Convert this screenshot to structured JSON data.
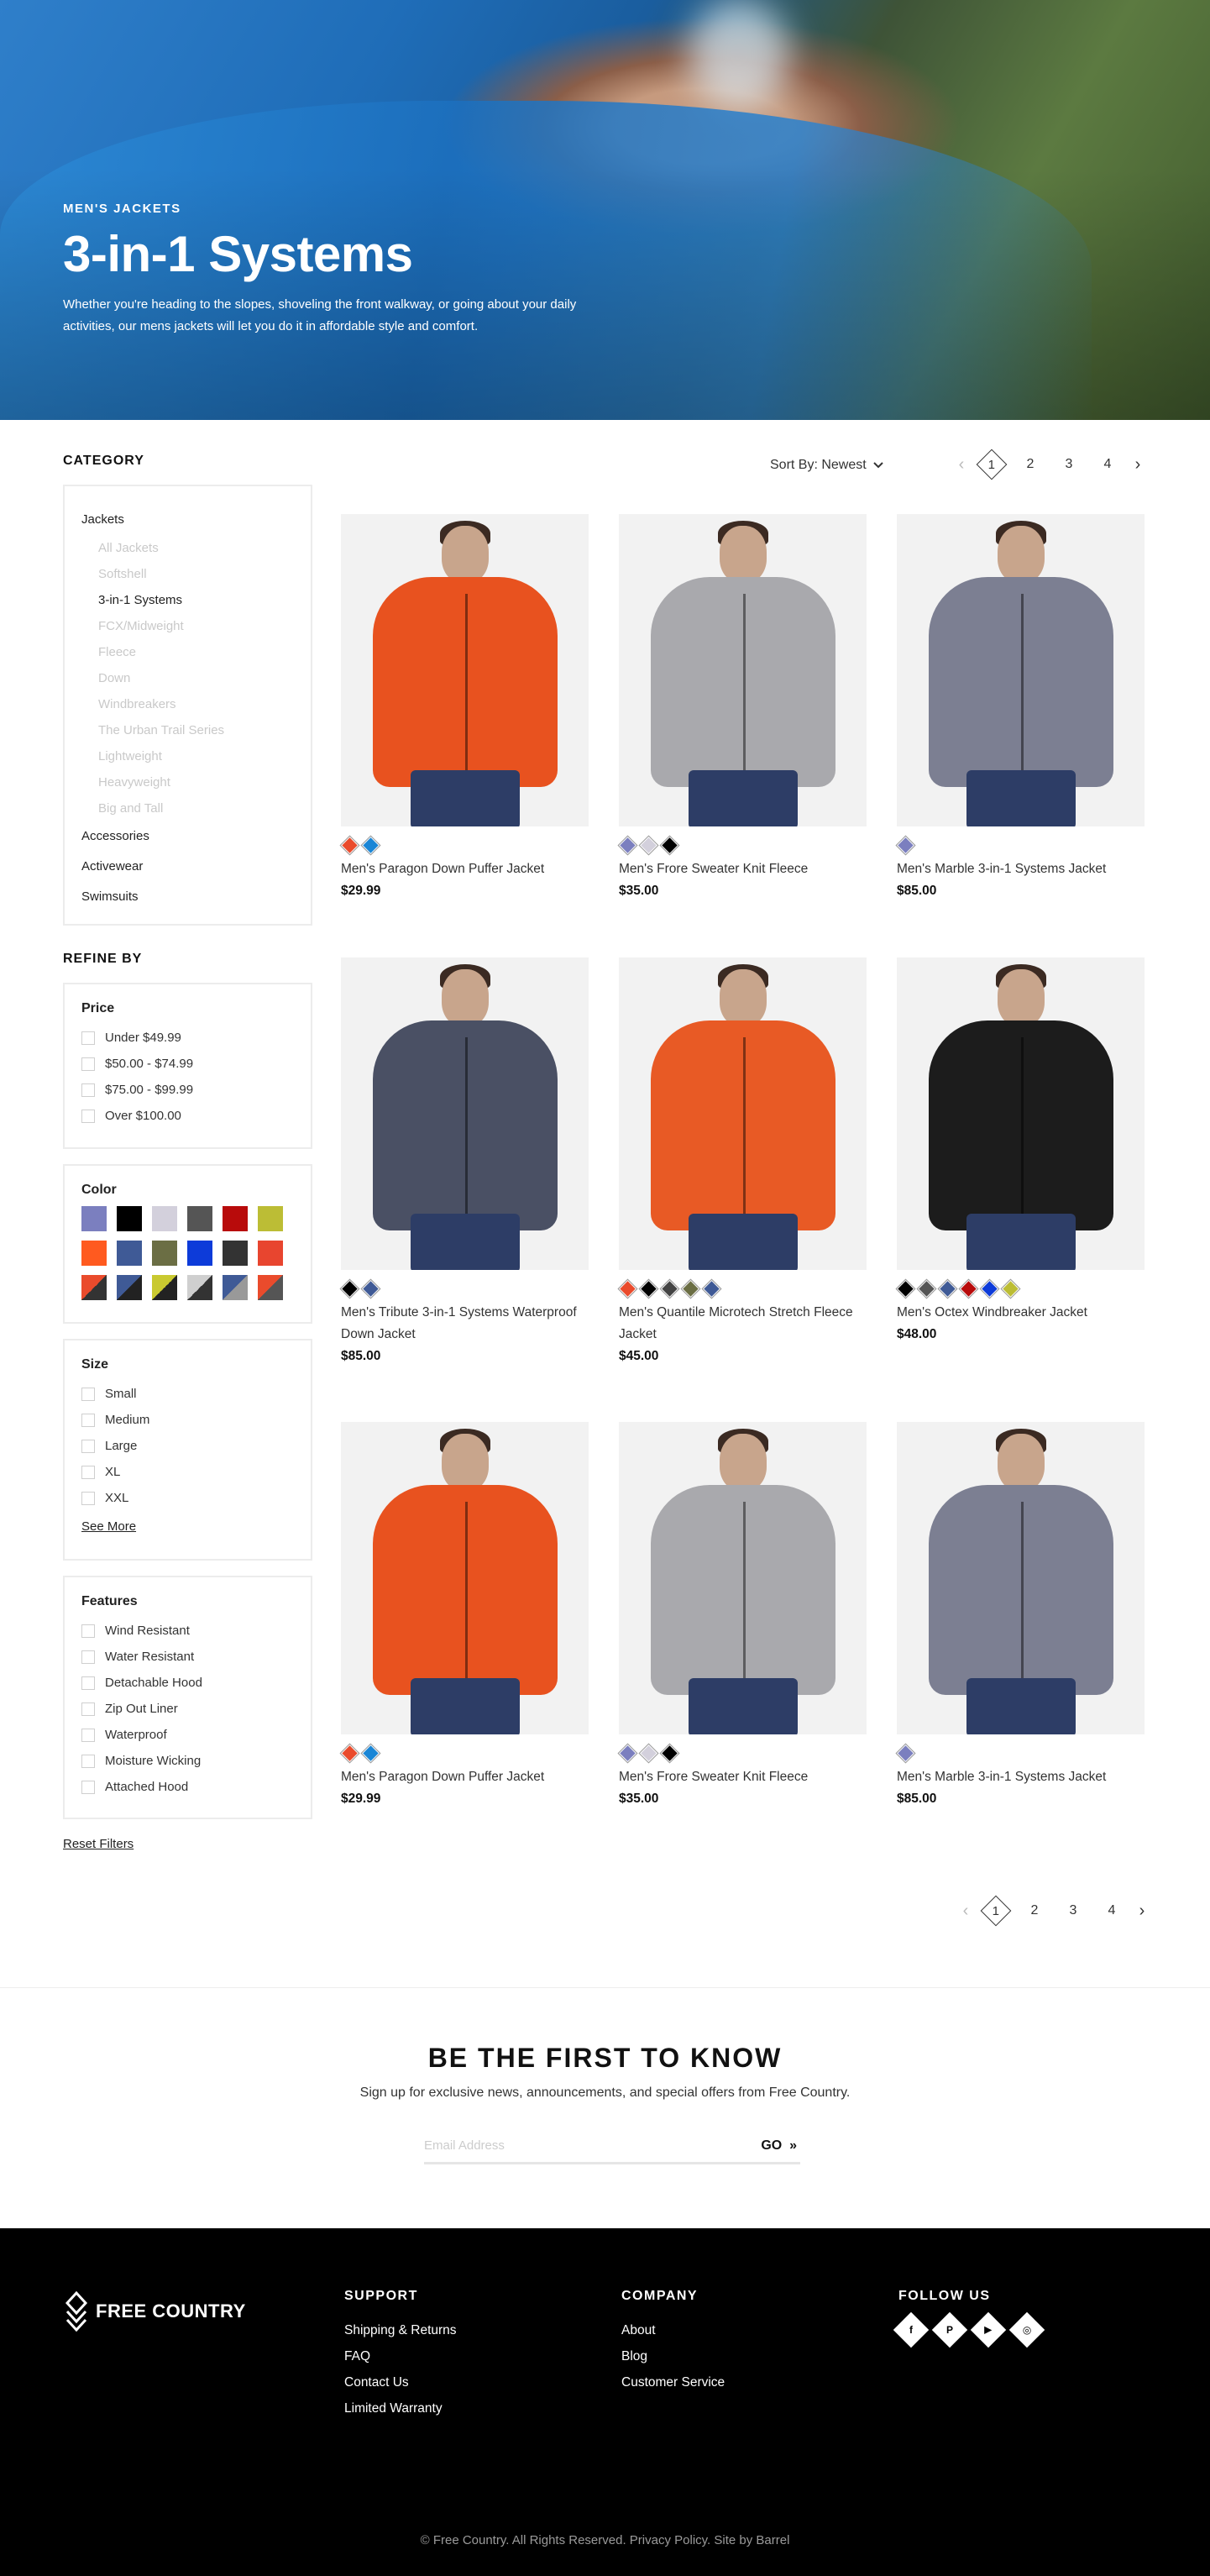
{
  "hero": {
    "eyebrow": "MEN'S JACKETS",
    "title": "3-in-1 Systems",
    "description": "Whether you're heading to the slopes, shoveling the front walkway, or going about your daily activities, our mens jackets will let you do it in affordable style and comfort."
  },
  "sidebar": {
    "category_heading": "CATEGORY",
    "categories": {
      "jackets": "Jackets",
      "sub": [
        "All Jackets",
        "Softshell",
        "3-in-1 Systems",
        "FCX/Midweight",
        "Fleece",
        "Down",
        "Windbreakers",
        "The Urban Trail Series",
        "Lightweight",
        "Heavyweight",
        "Big and Tall"
      ],
      "active_sub": "3-in-1 Systems",
      "accessories": "Accessories",
      "activewear": "Activewear",
      "swimsuits": "Swimsuits"
    },
    "refine_heading": "REFINE BY",
    "price": {
      "title": "Price",
      "options": [
        "Under $49.99",
        "$50.00 - $74.99",
        "$75.00 - $99.99",
        "Over $100.00"
      ]
    },
    "color": {
      "title": "Color",
      "swatches": [
        "#7b7fbf",
        "#000000",
        "#d3d0dc",
        "#555555",
        "#b80b0b",
        "#bcbd35",
        "#ff5a1f",
        "#3f5a96",
        "#6b6e44",
        "#0d3bd9",
        "#333333",
        "#e8452f",
        "#ea4b2c/#333333",
        "#3f5a96/#222222",
        "#c9c930/#222222",
        "#cfcfcf/#333333",
        "#3f5a96/#999999",
        "#ea4b2c/#555555"
      ]
    },
    "size": {
      "title": "Size",
      "options": [
        "Small",
        "Medium",
        "Large",
        "XL",
        "XXL"
      ],
      "see_more": "See More"
    },
    "features": {
      "title": "Features",
      "options": [
        "Wind Resistant",
        "Water Resistant",
        "Detachable Hood",
        "Zip Out Liner",
        "Waterproof",
        "Moisture Wicking",
        "Attached Hood"
      ]
    },
    "reset": "Reset Filters"
  },
  "toolbar": {
    "sort_label": "Sort By: Newest",
    "pages": [
      "1",
      "2",
      "3",
      "4"
    ],
    "current_page": "1"
  },
  "products": [
    {
      "name": "Men's Paragon Down Puffer Jacket",
      "price": "$29.99",
      "swatches": [
        "#ea4b2c",
        "#1a86d6"
      ],
      "jacket": "#e8521f"
    },
    {
      "name": "Men's Frore Sweater Knit Fleece",
      "price": "$35.00",
      "swatches": [
        "#7b7fbf",
        "#d3d0dc",
        "#000000"
      ],
      "jacket": "#a9a9ad"
    },
    {
      "name": "Men's Marble 3-in-1 Systems Jacket",
      "price": "$85.00",
      "swatches": [
        "#7b7fbf"
      ],
      "jacket": "#7c7f92"
    },
    {
      "name": "Men's Tribute 3-in-1 Systems Waterproof Down Jacket",
      "price": "$85.00",
      "swatches": [
        "#000000",
        "#3f5a96"
      ],
      "jacket": "#4a5064"
    },
    {
      "name": "Men's Quantile Microtech Stretch Fleece Jacket",
      "price": "$45.00",
      "swatches": [
        "#ea4b2c",
        "#000000",
        "#444444",
        "#6b6e44",
        "#3f5a96"
      ],
      "jacket": "#e85a25"
    },
    {
      "name": "Men's Octex Windbreaker Jacket",
      "price": "$48.00",
      "swatches": [
        "#000000",
        "#555555",
        "#3f5a96",
        "#b80b0b",
        "#0d3bd9",
        "#bcbd35"
      ],
      "jacket": "#1c1c1c"
    },
    {
      "name": "Men's Paragon Down Puffer Jacket",
      "price": "$29.99",
      "swatches": [
        "#ea4b2c",
        "#1a86d6"
      ],
      "jacket": "#e8521f"
    },
    {
      "name": "Men's Frore Sweater Knit Fleece",
      "price": "$35.00",
      "swatches": [
        "#7b7fbf",
        "#d3d0dc",
        "#000000"
      ],
      "jacket": "#a9a9ad"
    },
    {
      "name": "Men's Marble 3-in-1 Systems Jacket",
      "price": "$85.00",
      "swatches": [
        "#7b7fbf"
      ],
      "jacket": "#7c7f92"
    }
  ],
  "newsletter": {
    "title": "BE THE FIRST TO KNOW",
    "subtitle": "Sign up for exclusive news, announcements, and special offers from Free Country.",
    "placeholder": "Email Address",
    "go_label": "GO",
    "go_icon": "double-chevron-right-icon"
  },
  "footer": {
    "brand": "FREE COUNTRY",
    "support": {
      "title": "SUPPORT",
      "links": [
        "Shipping & Returns",
        "FAQ",
        "Contact Us",
        "Limited Warranty"
      ]
    },
    "company": {
      "title": "COMPANY",
      "links": [
        "About",
        "Blog",
        "Customer Service"
      ]
    },
    "follow": {
      "title": "FOLLOW US",
      "icons": [
        "facebook-icon",
        "pinterest-icon",
        "youtube-icon",
        "instagram-icon"
      ]
    },
    "copyright": "© Free Country. All Rights Reserved. Privacy Policy. Site by Barrel"
  }
}
